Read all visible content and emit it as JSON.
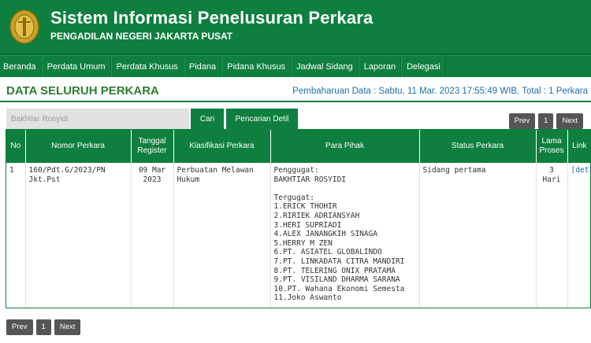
{
  "header": {
    "title": "Sistem Informasi Penelusuran Perkara",
    "subtitle": "PENGADILAN NEGERI JAKARTA PUSAT",
    "logo_icon": "court-emblem-icon"
  },
  "nav": {
    "items": [
      "Beranda",
      "Perdata Umum",
      "Perdata Khusus",
      "Pidana",
      "Pidana Khusus",
      "Jadwal Sidang",
      "Laporan",
      "Delegasi"
    ]
  },
  "page": {
    "title": "DATA SELURUH PERKARA",
    "update_info": "Pembaharuan Data : Sabtu, 11 Mar. 2023 17:55:49 WIB, Total : 1 Perkara"
  },
  "search": {
    "placeholder": "Bakhtiar Rosyidi",
    "cari_label": "Cari",
    "detil_label": "Pencarian Detil"
  },
  "pagination": {
    "prev": "Prev",
    "page": "1",
    "next": "Next"
  },
  "table": {
    "headers": [
      "No",
      "Nomor Perkara",
      "Tanggal Register",
      "Klasifikasi Perkara",
      "Para Pihak",
      "Status Perkara",
      "Lama Proses",
      "Link"
    ],
    "rows": [
      {
        "no": "1",
        "nomor": "160/Pdt.G/2023/PN Jkt.Pst",
        "tanggal": "09 Mar 2023",
        "klasifikasi": "Perbuatan Melawan Hukum",
        "penggugat_label": "Penggugat:",
        "penggugat": "BAKHTIAR ROSYIDI",
        "tergugat_label": "Tergugat:",
        "tergugat": [
          "1.ERICK THOHIR",
          "2.RIRIEK ADRIANSYAH",
          "3.HERI SUPRIADI",
          "4.ALEX JANANGKIH SINAGA",
          "5.HERRY M ZEN",
          "6.PT. ASIATEL GLOBALINDO",
          "7.PT. LINKADATA CITRA MANDIRI",
          "8.PT. TELERING ONIX PRATAMA",
          "9.PT. VISILAND DHARMA SARANA",
          "10.PT. Wahana Ekonomi Semesta",
          "11.Joko Aswanto"
        ],
        "status": "Sidang pertama",
        "lama": "3 Hari",
        "link": "[detil]"
      }
    ]
  },
  "colors": {
    "primary_green": "#0e7f3e",
    "title_green": "#2e7d32",
    "link_blue": "#1e6fa8"
  }
}
